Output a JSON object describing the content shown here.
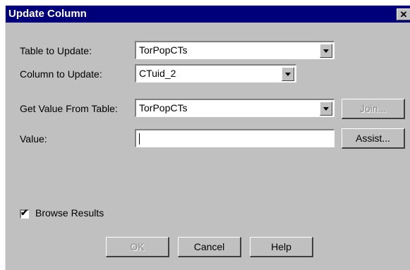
{
  "dialog": {
    "title": "Update Column",
    "close_symbol": "✕"
  },
  "fields": {
    "table_to_update": {
      "label": "Table to Update:",
      "value": "TorPopCTs"
    },
    "column_to_update": {
      "label": "Column to Update:",
      "value": "CTuid_2"
    },
    "get_value_from_table": {
      "label": "Get Value From Table:",
      "value": "TorPopCTs"
    },
    "value": {
      "label": "Value:",
      "value": ""
    }
  },
  "buttons": {
    "join": {
      "label": "Join...",
      "enabled": false
    },
    "assist": {
      "label": "Assist..."
    },
    "ok": {
      "label": "OK",
      "enabled": false
    },
    "cancel": {
      "label": "Cancel"
    },
    "help": {
      "label": "Help"
    }
  },
  "browse_results": {
    "label": "Browse Results",
    "checked": true
  },
  "icons": {
    "close": "close-icon",
    "dropdown": "chevron-down-icon",
    "check": "checkmark-icon"
  },
  "colors": {
    "titlebar": "#00007b",
    "dialog_bg": "#c0c0c0"
  }
}
